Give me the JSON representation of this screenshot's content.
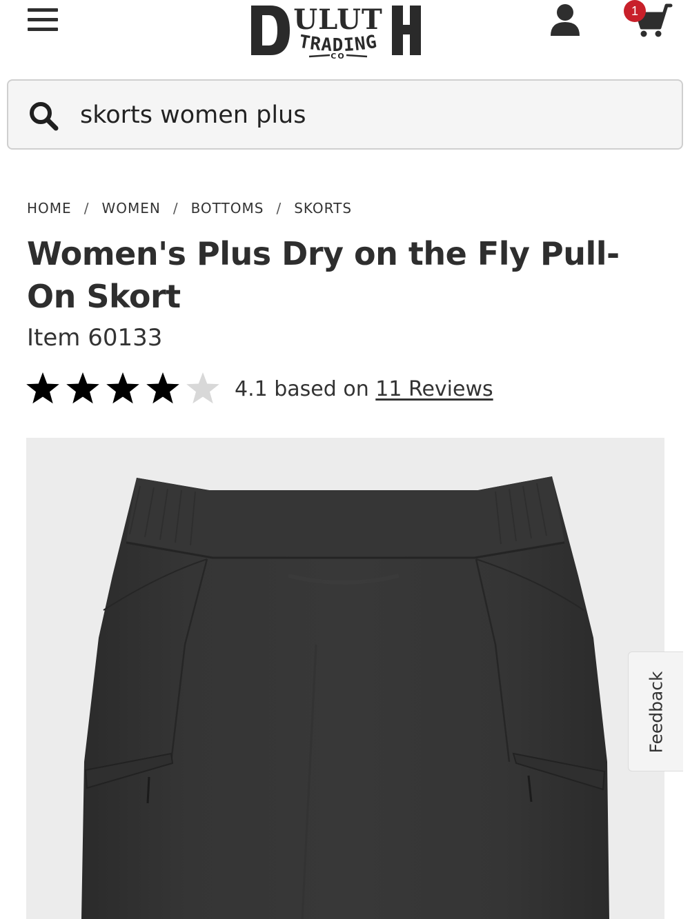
{
  "header": {
    "logo": {
      "brand": "DULUTH",
      "line2": "TRADING",
      "line3": "CO"
    },
    "cart_count": "1"
  },
  "search": {
    "value": "skorts women plus"
  },
  "breadcrumb": [
    "HOME",
    "WOMEN",
    "BOTTOMS",
    "SKORTS"
  ],
  "breadcrumb_separator": "/",
  "product": {
    "title": "Women's Plus Dry on the Fly Pull-On Skort",
    "item_number": "Item 60133",
    "rating": {
      "value": 4.1,
      "max": 5,
      "text_prefix": "4.1 based on",
      "reviews_link": "11 Reviews",
      "filled_color": "#000000",
      "empty_color": "#d8d8d8"
    },
    "image_background": "#ececec",
    "garment_color": "#333333"
  },
  "feedback": {
    "label": "Feedback"
  },
  "icons": {
    "menu": "hamburger-menu-icon",
    "account": "user-icon",
    "cart": "shopping-cart-icon",
    "search": "search-icon",
    "star": "star-icon"
  }
}
